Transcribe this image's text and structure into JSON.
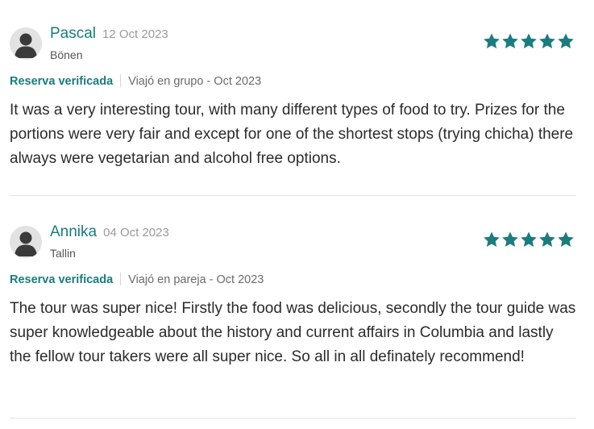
{
  "colors": {
    "accent": "#1a7c7f",
    "star": "#1a7c7f",
    "divider": "#e4e4e4"
  },
  "reviews": [
    {
      "name": "Pascal",
      "date": "12 Oct 2023",
      "location": "Bönen",
      "rating": 5,
      "verified": "Reserva verificada",
      "trip": "Viajó en grupo - Oct 2023",
      "text": "It was a very interesting tour, with many different types of food to try. Prizes for the portions were very fair and except for one of the shortest stops (trying chicha) there always were vegetarian and alcohol free options."
    },
    {
      "name": "Annika",
      "date": "04 Oct 2023",
      "location": "Tallin",
      "rating": 5,
      "verified": "Reserva verificada",
      "trip": "Viajó en pareja - Oct 2023",
      "text": "The tour was super nice! Firstly the food was delicious, secondly the tour guide was super knowledgeable about the history and current affairs in Columbia and lastly the fellow tour takers were all super nice. So all in all definately recommend!"
    }
  ]
}
